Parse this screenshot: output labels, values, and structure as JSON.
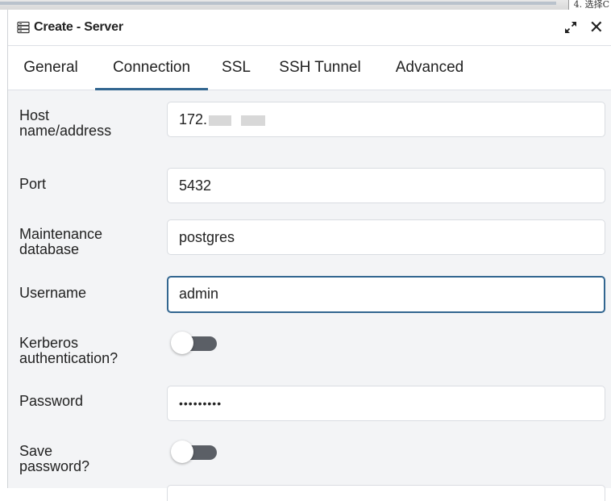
{
  "background_window": {
    "corner_text": "4. 选择C"
  },
  "dialog": {
    "title": "Create - Server",
    "title_icon": "server-icon",
    "actions": {
      "expand_icon": "expand-icon",
      "close_glyph": "✕"
    }
  },
  "tabs": [
    {
      "label": "General",
      "active": false
    },
    {
      "label": "Connection",
      "active": true
    },
    {
      "label": "SSL",
      "active": false
    },
    {
      "label": "SSH Tunnel",
      "active": false
    },
    {
      "label": "Advanced",
      "active": false
    }
  ],
  "fields": {
    "host": {
      "label_line1": "Host",
      "label_line2": "name/address",
      "value": "172."
    },
    "port": {
      "label": "Port",
      "value": "5432"
    },
    "maintenance_db": {
      "label_line1": "Maintenance",
      "label_line2": "database",
      "value": "postgres"
    },
    "username": {
      "label": "Username",
      "value": "admin"
    },
    "kerberos": {
      "label_line1": "Kerberos",
      "label_line2": "authentication?",
      "enabled": false
    },
    "password": {
      "label": "Password",
      "value": "•••••••••"
    },
    "save_password": {
      "label_line1": "Save",
      "label_line2": "password?",
      "enabled": false
    }
  },
  "colors": {
    "accent": "#326690",
    "form_background": "#f3f4f6",
    "toggle_track": "#5b5f66"
  }
}
